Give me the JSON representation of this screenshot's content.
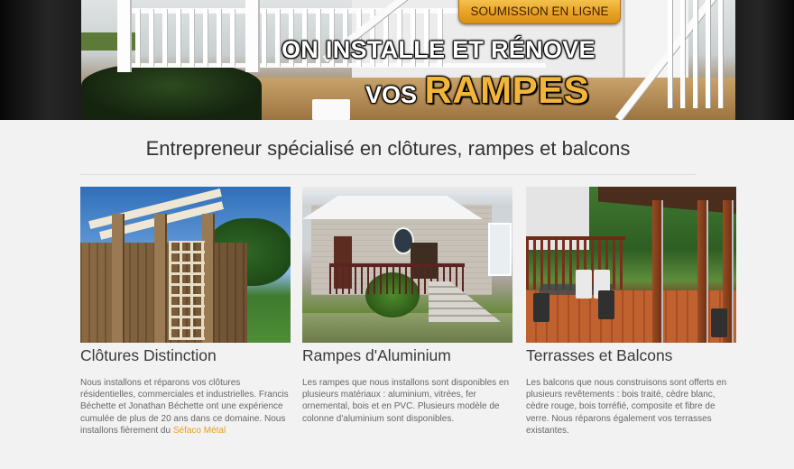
{
  "hero": {
    "cta_label": "SOUMISSION EN LIGNE",
    "headline_line1": "ON INSTALLE ET RÉNOVE",
    "headline_vos": "VOS",
    "headline_rampes": "RAMPES"
  },
  "tagline": "Entrepreneur spécialisé en clôtures, rampes et balcons",
  "services": [
    {
      "title": "Clôtures Distinction",
      "text": "Nous installons et réparons vos clôtures résidentielles, commerciales et industrielles. Francis Béchette et Jonathan Béchette ont une expérience cumulée de plus de 20 ans dans ce domaine. Nous installons fièrement du",
      "link": "Séfaco Métal"
    },
    {
      "title": "Rampes d'Aluminium",
      "text": "Les rampes que nous installons sont disponibles en plusieurs matériaux : aluminium, vitrées, fer ornemental, bois et en PVC. Plusieurs modèle de colonne d'aluminium sont disponibles."
    },
    {
      "title": "Terrasses et Balcons",
      "text": "Les balcons que nous construisons sont offerts en plusieurs revêtements : bois traité, cèdre blanc, cèdre rouge, bois torréfié, composite et fibre de verre. Nous réparons également vos terrasses existantes."
    }
  ],
  "colors": {
    "accent": "#e89d1c",
    "cta_gradient_top": "#f7cd5b",
    "headline_gold": "#f2b43a",
    "background": "#f2f2f2"
  }
}
